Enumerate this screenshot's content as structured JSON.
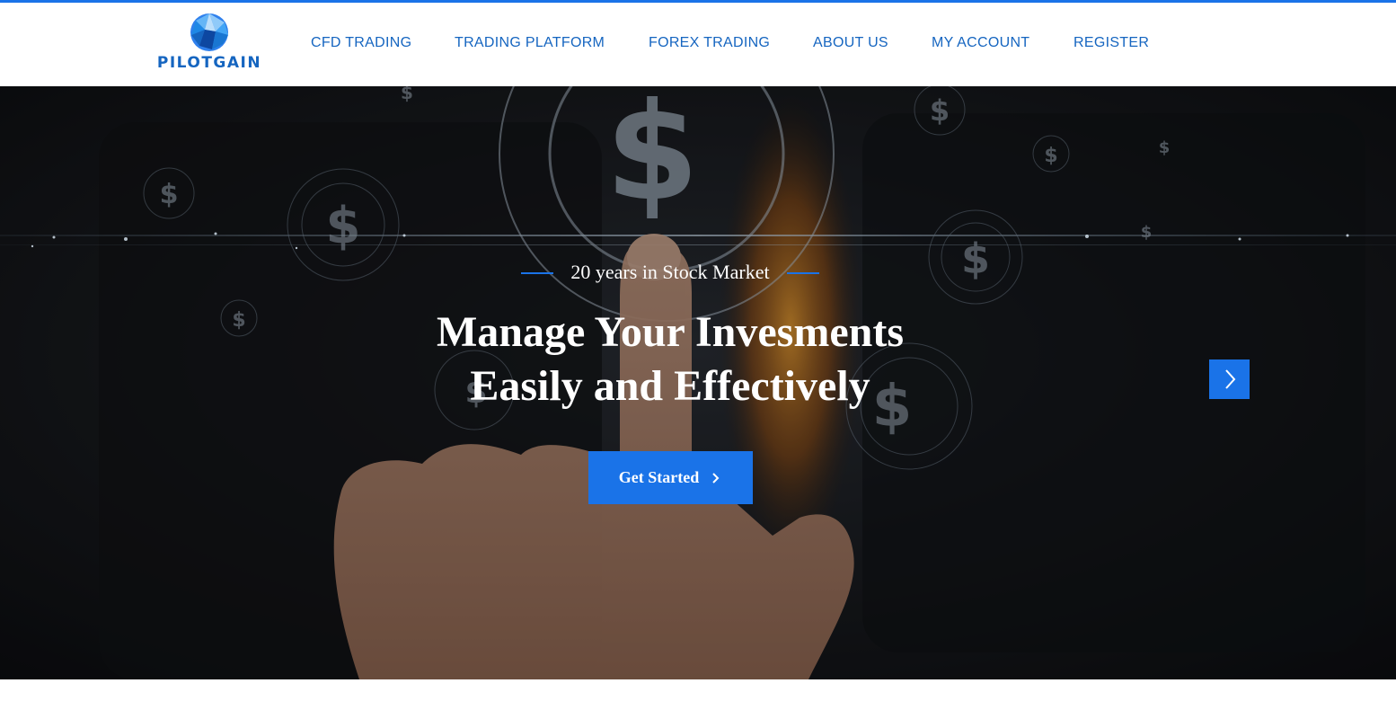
{
  "brand": {
    "name": "PILOTGAIN",
    "logo_icon": "faceted-globe-icon"
  },
  "nav": {
    "items": [
      {
        "label": "CFD TRADING"
      },
      {
        "label": "TRADING PLATFORM"
      },
      {
        "label": "FOREX TRADING"
      },
      {
        "label": "ABOUT US"
      },
      {
        "label": "MY ACCOUNT"
      },
      {
        "label": "REGISTER"
      }
    ]
  },
  "hero": {
    "eyebrow": "20 years in Stock Market",
    "headline_line1": "Manage Your Invesments",
    "headline_line2": "Easily and Effectively",
    "cta_label": "Get Started",
    "cta_icon": "chevron-right-icon",
    "next_icon": "chevron-right-icon",
    "background_icon": "dollar-icon"
  },
  "colors": {
    "accent": "#1a73e8",
    "nav_text": "#1565c0",
    "hero_dark": "#15171b",
    "white": "#ffffff"
  }
}
